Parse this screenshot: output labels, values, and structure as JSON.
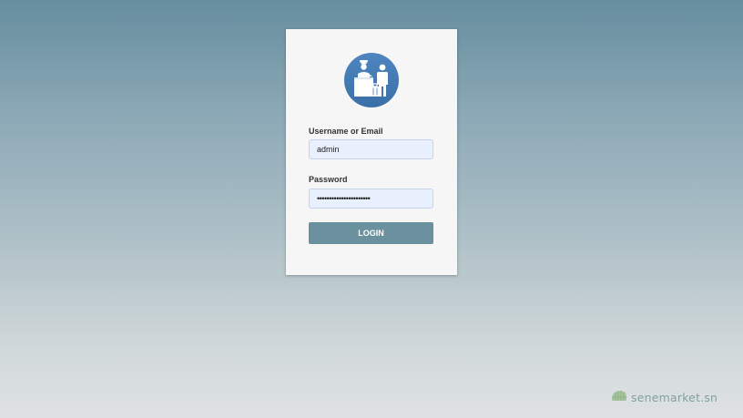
{
  "login_form": {
    "logo_icon": "hotel-reception-icon",
    "username_label": "Username or Email",
    "username_value": "admin",
    "password_label": "Password",
    "password_value": "admin1234567890admin12",
    "login_label": "LOGIN"
  },
  "watermark": {
    "text": "senemarket.sn",
    "icon": "senemarket-logo-icon"
  },
  "colors": {
    "accent": "#6b919f",
    "logo_circle": "#3f78b4",
    "input_bg": "#e8f0fe",
    "card_bg": "#f6f6f6"
  }
}
